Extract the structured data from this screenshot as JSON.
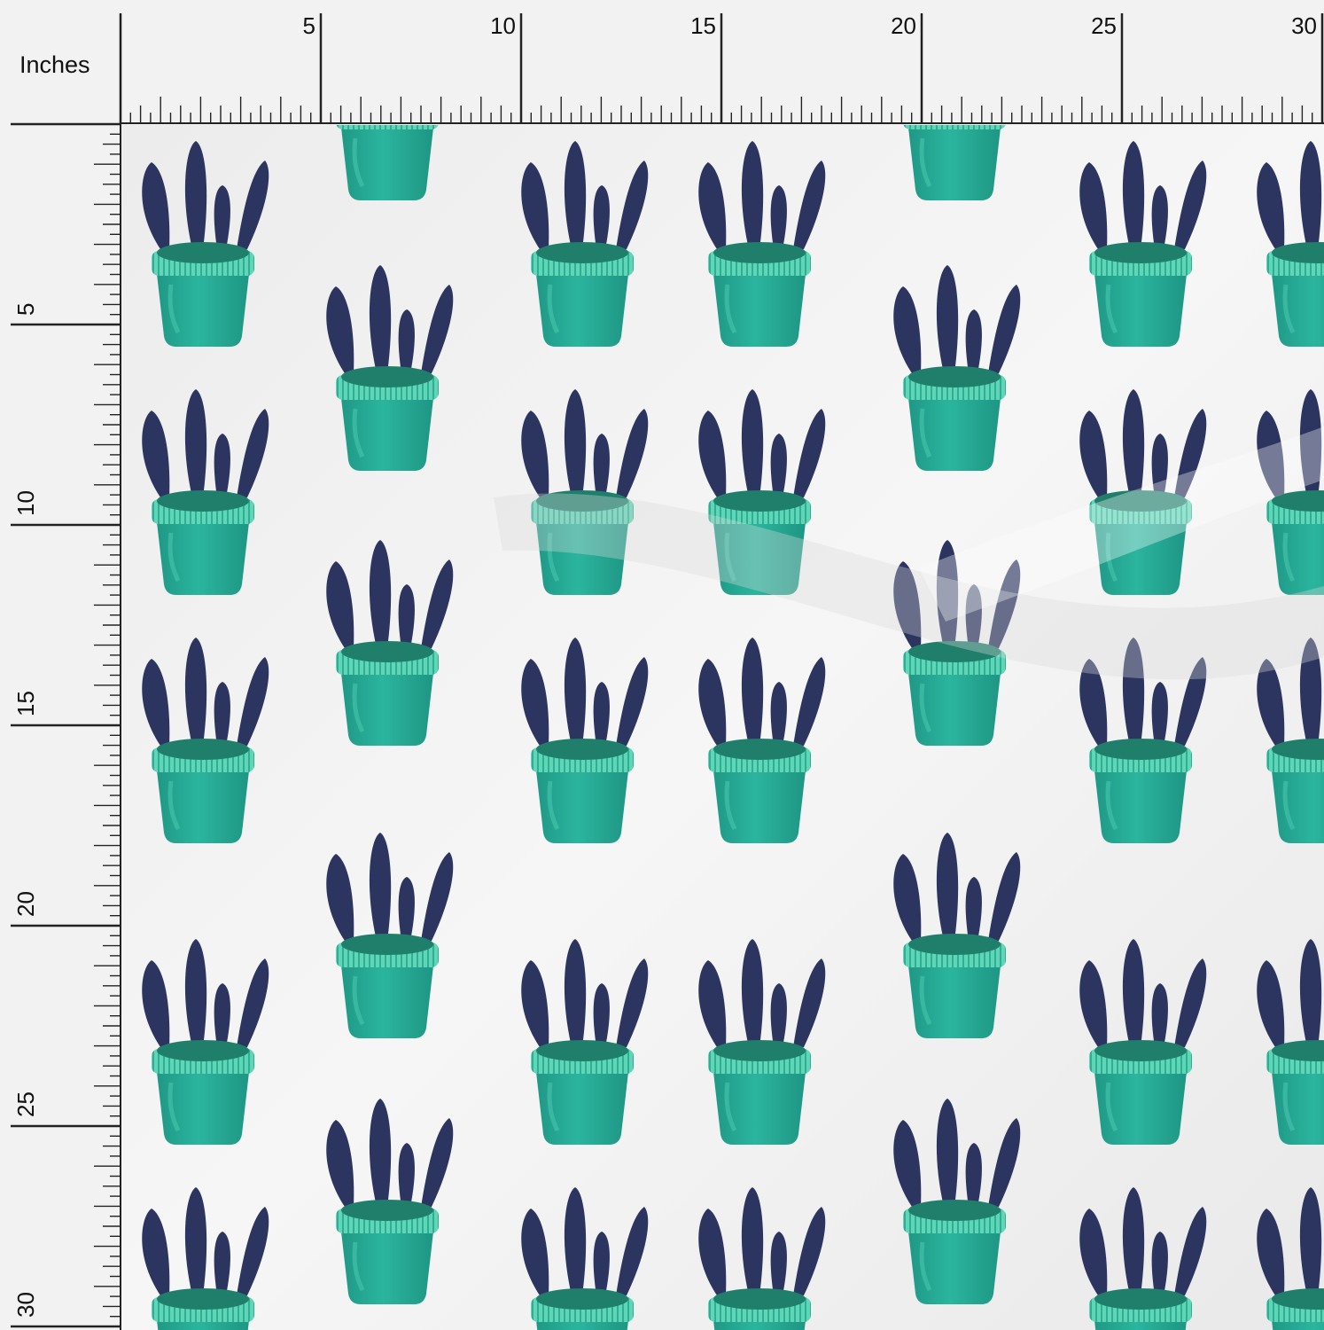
{
  "ruler": {
    "units_label": "Inches",
    "top_labels": [
      "5",
      "10",
      "15",
      "20",
      "25",
      "30"
    ],
    "left_labels": [
      "5",
      "10",
      "15",
      "20",
      "25",
      "30"
    ]
  },
  "fabric": {
    "motif": "potted-plant",
    "colors": {
      "background": "#efefef",
      "leaf": "#2c3560",
      "pot": "#25a895",
      "pot_rim": "#5ad3b4",
      "soil": "#1f7f6a"
    }
  }
}
